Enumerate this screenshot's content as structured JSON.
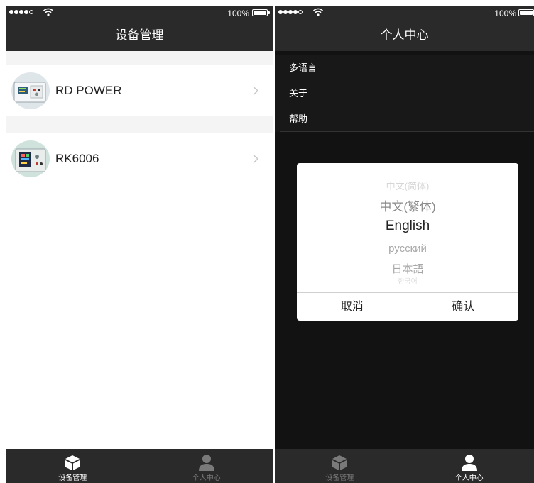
{
  "status": {
    "battery": "100%"
  },
  "device_screen": {
    "title": "设备管理",
    "devices": [
      {
        "name": "RD POWER",
        "icon": "rd-power-device-photo"
      },
      {
        "name": "RK6006",
        "icon": "rk6006-device-photo"
      }
    ]
  },
  "profile_screen": {
    "title": "个人中心",
    "menu": [
      {
        "label": "多语言"
      },
      {
        "label": "关于"
      },
      {
        "label": "帮助"
      }
    ],
    "language_picker": {
      "options": [
        "中文(简体)",
        "中文(繁体)",
        "English",
        "русский",
        "日本語",
        "한국어"
      ],
      "selected": "English",
      "cancel_label": "取消",
      "confirm_label": "确认"
    }
  },
  "tabs": [
    {
      "label": "设备管理",
      "icon": "cube-icon"
    },
    {
      "label": "个人中心",
      "icon": "person-icon"
    }
  ],
  "colors": {
    "bar_background": "#2a2a2a",
    "profile_background": "#121212",
    "inactive_tab": "#7a7a7a"
  }
}
